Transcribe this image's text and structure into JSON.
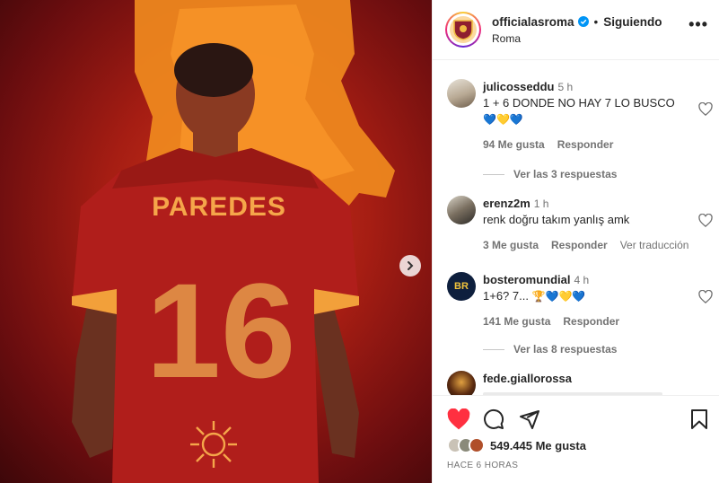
{
  "post": {
    "username": "officialasroma",
    "follow_status": "Siguiendo",
    "separator": "•",
    "location": "Roma",
    "more_label": "•••",
    "image": {
      "jersey_name": "PAREDES",
      "jersey_number": "16"
    }
  },
  "comments": [
    {
      "username": "julicosseddu",
      "time": "5 h",
      "text": "1 + 6 DONDE NO HAY 7 LO BUSCO",
      "emoji": "💙💛💙",
      "likes": "94 Me gusta",
      "reply": "Responder",
      "replies": "Ver las 3 respuestas"
    },
    {
      "username": "erenz2m",
      "time": "1 h",
      "text": "renk doğru takım yanlış amk",
      "likes": "3 Me gusta",
      "reply": "Responder",
      "translate": "Ver traducción"
    },
    {
      "username": "bosteromundial",
      "time": "4 h",
      "text": "1+6? 7...",
      "emoji": "🏆💙💛💙",
      "likes": "141 Me gusta",
      "reply": "Responder",
      "replies": "Ver las 8 respuestas"
    },
    {
      "username": "fede.giallorossa"
    }
  ],
  "footer": {
    "likes": "549.445 Me gusta",
    "time_ago": "HACE 6 HORAS"
  },
  "colors": {
    "like_red": "#ff3040",
    "verified_blue": "#0095f6"
  },
  "icons": [
    "next-arrow-icon",
    "verified-icon",
    "heart-icon",
    "comment-icon",
    "share-icon",
    "bookmark-icon"
  ]
}
